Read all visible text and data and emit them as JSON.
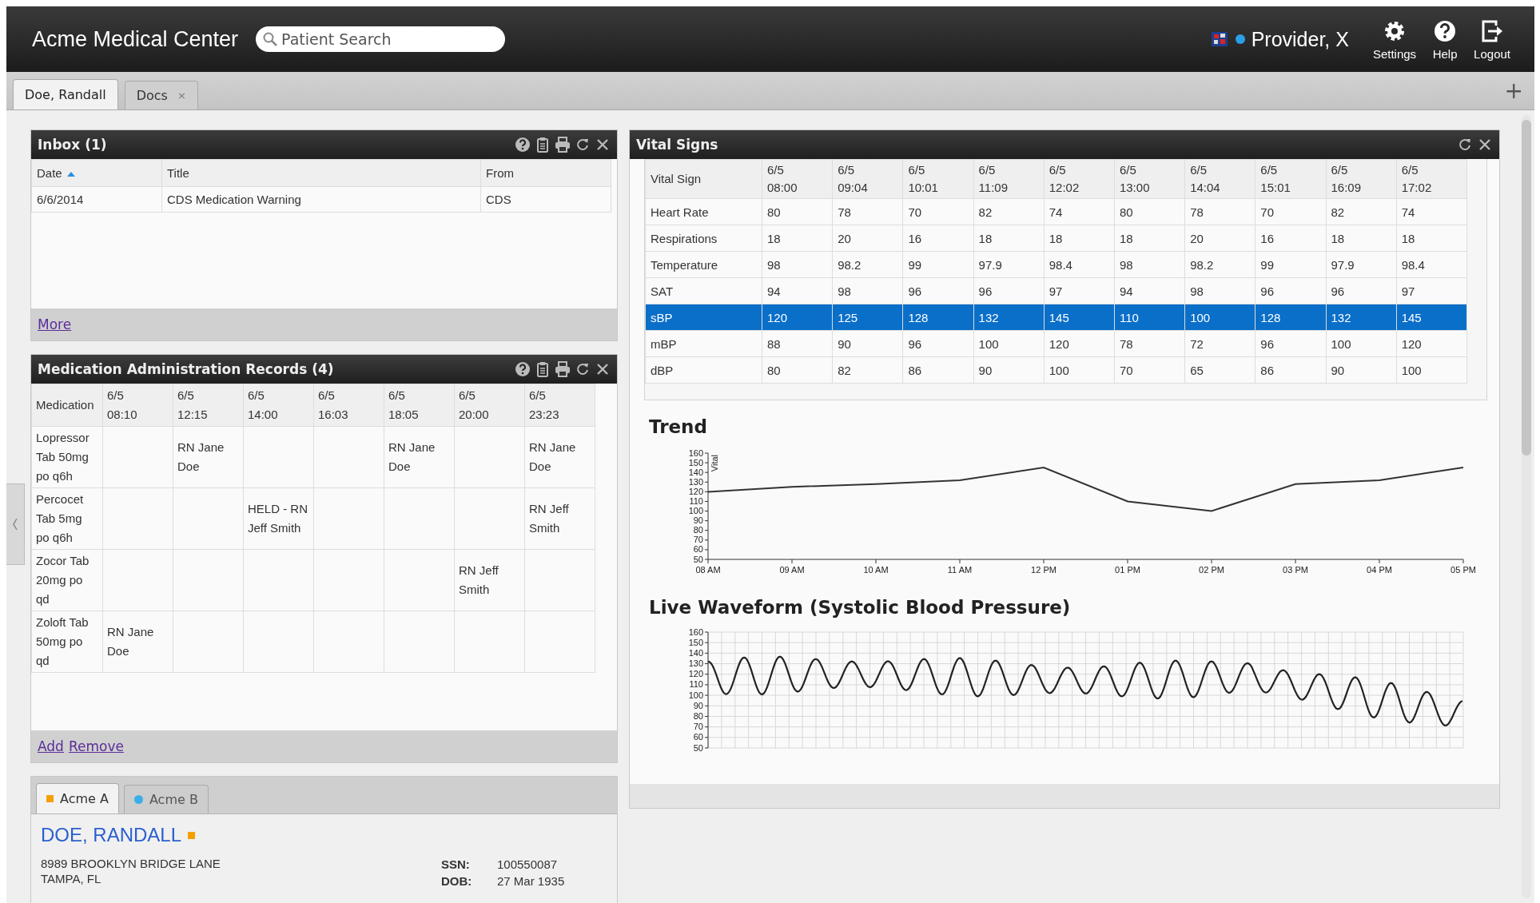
{
  "header": {
    "title": "Acme Medical Center",
    "search": {
      "placeholder": "Patient Search"
    },
    "user": {
      "name": "Provider, X",
      "online": true
    },
    "actions": [
      {
        "label": "Settings",
        "kind": "settings"
      },
      {
        "label": "Help",
        "kind": "help"
      },
      {
        "label": "Logout",
        "kind": "logout"
      }
    ]
  },
  "tabs": [
    {
      "label": "Doe, Randall",
      "selected": true
    },
    {
      "label": "Docs",
      "selected": false,
      "close": "×"
    }
  ],
  "add_tab": "+",
  "inbox": {
    "title": "Inbox (1)",
    "tools": {
      "help": true,
      "clipboard": true,
      "print": true,
      "refresh": true,
      "close": true
    },
    "columns": [
      {
        "label": "Date",
        "sorted": true
      },
      {
        "label": "Title",
        "sorted": false
      },
      {
        "label": "From",
        "sorted": false
      }
    ],
    "rows": [
      [
        "6/6/2014",
        "CDS Medication Warning",
        "CDS"
      ]
    ],
    "links": [
      "More"
    ]
  },
  "mar": {
    "title": "Medication Administration Records (4)",
    "tools": {
      "help": true,
      "clipboard": true,
      "print": true,
      "refresh": true,
      "close": true
    },
    "first_column": "Medication",
    "columns": [
      {
        "date": "6/5",
        "time": "08:10"
      },
      {
        "date": "6/5",
        "time": "12:15"
      },
      {
        "date": "6/5",
        "time": "14:00"
      },
      {
        "date": "6/5",
        "time": "16:03"
      },
      {
        "date": "6/5",
        "time": "18:05"
      },
      {
        "date": "6/5",
        "time": "20:00"
      },
      {
        "date": "6/5",
        "time": "23:23"
      }
    ],
    "rows": [
      {
        "medication": "Lopressor Tab 50mg po q6h",
        "cells": [
          null,
          "RN Jane Doe",
          null,
          null,
          "RN Jane Doe",
          null,
          "RN Jane Doe"
        ]
      },
      {
        "medication": "Percocet Tab 5mg po q6h",
        "cells": [
          null,
          null,
          "HELD - RN Jeff Smith",
          null,
          null,
          null,
          "RN Jeff Smith"
        ]
      },
      {
        "medication": "Zocor Tab 20mg po qd",
        "cells": [
          null,
          null,
          null,
          null,
          null,
          "RN Jeff Smith",
          null
        ]
      },
      {
        "medication": "Zoloft Tab 50mg po qd",
        "cells": [
          "RN Jane Doe",
          null,
          null,
          null,
          null,
          null,
          null
        ]
      }
    ],
    "links": [
      "Add",
      "Remove"
    ]
  },
  "patient": {
    "tabs": [
      {
        "label": "Acme A",
        "color": "#f5a000",
        "kind": "square",
        "selected": true
      },
      {
        "label": "Acme B",
        "color": "#3aaee8",
        "kind": "dot",
        "selected": false
      }
    ],
    "name": "DOE, RANDALL",
    "name_tag": {
      "color": "#f5a000"
    },
    "address": [
      "8989 BROOKLYN BRIDGE LANE",
      "TAMPA, FL"
    ],
    "fields": [
      {
        "label": "SSN:",
        "value": "100550087"
      },
      {
        "label": "DOB:",
        "value": "27 Mar 1935"
      }
    ]
  },
  "vitals": {
    "title": "Vital Signs",
    "tools": {
      "refresh": true,
      "close": true
    },
    "first_column": "Vital Sign",
    "columns": [
      {
        "date": "6/5",
        "time": "08:00"
      },
      {
        "date": "6/5",
        "time": "09:04"
      },
      {
        "date": "6/5",
        "time": "10:01"
      },
      {
        "date": "6/5",
        "time": "11:09"
      },
      {
        "date": "6/5",
        "time": "12:02"
      },
      {
        "date": "6/5",
        "time": "13:00"
      },
      {
        "date": "6/5",
        "time": "14:04"
      },
      {
        "date": "6/5",
        "time": "15:01"
      },
      {
        "date": "6/5",
        "time": "16:09"
      },
      {
        "date": "6/5",
        "time": "17:02"
      }
    ],
    "rows": [
      {
        "name": "Heart Rate",
        "values": [
          "80",
          "78",
          "70",
          "82",
          "74",
          "80",
          "78",
          "70",
          "82",
          "74"
        ],
        "selected": false
      },
      {
        "name": "Respirations",
        "values": [
          "18",
          "20",
          "16",
          "18",
          "18",
          "18",
          "20",
          "16",
          "18",
          "18"
        ],
        "selected": false
      },
      {
        "name": "Temperature",
        "values": [
          "98",
          "98.2",
          "99",
          "97.9",
          "98.4",
          "98",
          "98.2",
          "99",
          "97.9",
          "98.4"
        ],
        "selected": false
      },
      {
        "name": "SAT",
        "values": [
          "94",
          "98",
          "96",
          "96",
          "97",
          "94",
          "98",
          "96",
          "96",
          "97"
        ],
        "selected": false
      },
      {
        "name": "sBP",
        "values": [
          "120",
          "125",
          "128",
          "132",
          "145",
          "110",
          "100",
          "128",
          "132",
          "145"
        ],
        "selected": true
      },
      {
        "name": "mBP",
        "values": [
          "88",
          "90",
          "96",
          "100",
          "120",
          "78",
          "72",
          "96",
          "100",
          "120"
        ],
        "selected": false
      },
      {
        "name": "dBP",
        "values": [
          "80",
          "82",
          "86",
          "90",
          "100",
          "70",
          "65",
          "86",
          "90",
          "100"
        ],
        "selected": false
      }
    ]
  },
  "trend": {
    "title": "Trend",
    "chart_data": {
      "type": "line",
      "ylabel": "Vital",
      "categories": [
        "08 AM",
        "09 AM",
        "10 AM",
        "11 AM",
        "12 PM",
        "01 PM",
        "02 PM",
        "03 PM",
        "04 PM",
        "05 PM"
      ],
      "series": [
        {
          "color": "#333333",
          "values": [
            120,
            125,
            128,
            132,
            145,
            110,
            100,
            128,
            132,
            145
          ]
        }
      ],
      "ylim": [
        50,
        160
      ],
      "yticks": [
        50,
        60,
        70,
        80,
        90,
        100,
        110,
        120,
        130,
        140,
        150,
        160
      ]
    }
  },
  "waveform": {
    "title": "Live Waveform (Systolic Blood Pressure)",
    "y_tick_labels": [
      "160",
      "150",
      "140",
      "130",
      "120",
      "110",
      "100",
      "90",
      "80",
      "70",
      "60",
      "50"
    ]
  }
}
